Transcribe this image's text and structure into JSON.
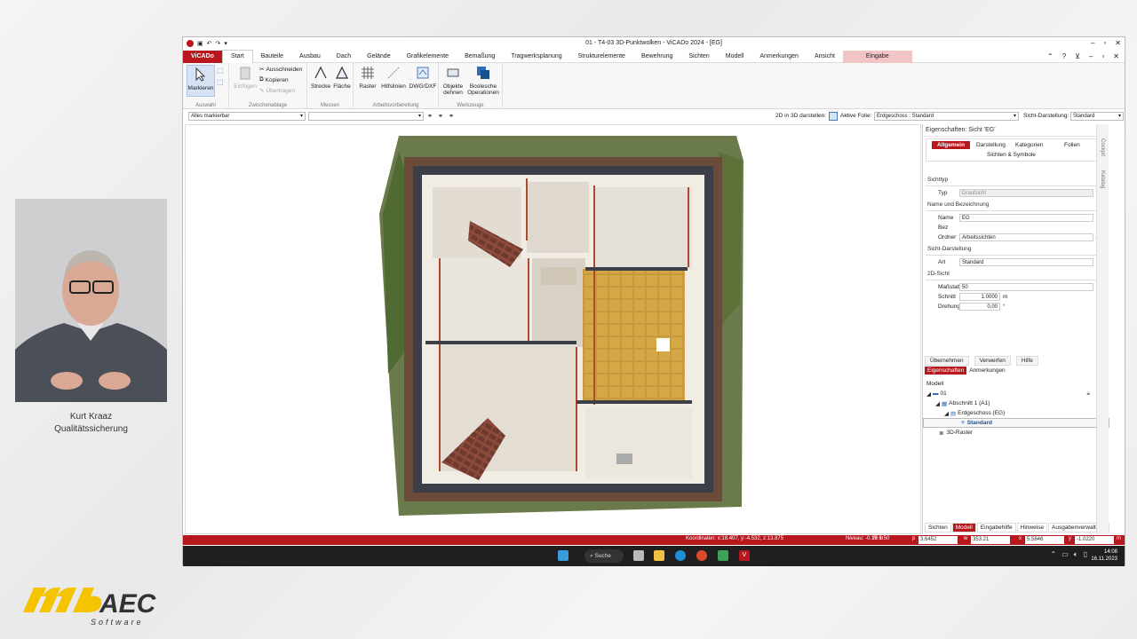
{
  "presenter": {
    "name": "Kurt Kraaz",
    "role": "Qualitätssicherung"
  },
  "logo": {
    "text": "mbAEC",
    "subtitle": "Software"
  },
  "window": {
    "title": "01 - T4-03 3D-Punktwolken - ViCADo 2024 - [EG]"
  },
  "menu": {
    "app_tab": "ViCADo",
    "tabs": [
      "Start",
      "Bauteile",
      "Ausbau",
      "Dach",
      "Gelände",
      "Grafikelemente",
      "Bemaßung",
      "Tragwerksplanung",
      "Strukturelemente",
      "Bewehrung",
      "Sichten",
      "Modell",
      "Anmerkungen",
      "Ansicht"
    ],
    "context_tab": "Eingabe"
  },
  "ribbon": {
    "auswahl": {
      "label": "Auswahl",
      "markieren": "Markieren"
    },
    "zwischenablage": {
      "label": "Zwischenablage",
      "einfuegen": "Einfügen",
      "ausschneiden": "Ausschneiden",
      "kopieren": "Kopieren",
      "uebertragen": "Übertragen"
    },
    "messen": {
      "label": "Messen",
      "strecke": "Strecke",
      "flaeche": "Fläche"
    },
    "arbeitsvorbereitung": {
      "label": "Arbeitsvorbereitung",
      "raster": "Raster",
      "hilfslinien": "Hilfslinien",
      "dwg": "DWG/DXF"
    },
    "werkzeuge": {
      "label": "Werkzeuge",
      "objekte1": "Objekte",
      "objekte2": "dehnen",
      "bool1": "Boolesche",
      "bool2": "Operationen"
    }
  },
  "options": {
    "filter": "Alles markierbar",
    "show3d_label": "2D in 3D darstellen:",
    "aktive_folie_label": "Aktive Folie:",
    "aktive_folie": "Erdgeschoss : Standard",
    "sicht_darstellung_label": "Sicht-Darstellung:",
    "sicht_darstellung": "Standard"
  },
  "properties": {
    "title": "Eigenschaften: Sicht 'EG'",
    "tabs": [
      "Allgemein",
      "Darstellung",
      "Kategorien",
      "Folien",
      "Sichten & Symbole"
    ],
    "sichttyp": {
      "header": "Sichttyp",
      "typ_label": "Typ",
      "typ": "Draufsicht"
    },
    "name": {
      "header": "Name und Bezeichnung",
      "name_label": "Name",
      "name": "EG",
      "bez_label": "Bez",
      "ordner_label": "Ordner",
      "ordner": "Arbeitssichten"
    },
    "darstellung": {
      "header": "Sicht-Darstellung",
      "art_label": "Art",
      "art": "Standard"
    },
    "sicht2d": {
      "header": "2D-Sicht",
      "massstab_label": "Maßstab",
      "massstab": "50",
      "schnitt_label": "Schnitt",
      "schnitt": "1.0000",
      "schnitt_unit": "m",
      "drehung_label": "Drehung",
      "drehung": "0.00",
      "drehung_unit": "°"
    },
    "buttons": [
      "Übernehmen",
      "Verwerfen",
      "Hilfe"
    ]
  },
  "model_panel": {
    "tabs": [
      "Eigenschaften",
      "Anmerkungen"
    ],
    "header": "Modell",
    "items": [
      "01",
      "Abschnitt 1 (A1)",
      "Erdgeschoss (EG)",
      "Standard",
      "3D-Raster"
    ]
  },
  "side_tabs": [
    "Cockpit",
    "Katalog"
  ],
  "bottom_tabs": [
    "Sichten",
    "Modell",
    "Eingabehilfe",
    "Hinweise",
    "Ausgabenverwaltung"
  ],
  "status": {
    "koordinaten": "Koordinaten: x:18.407, y:-4.532, z:13.875",
    "niveau": "Niveau: -0.15 m",
    "massstab": "M 1:50",
    "p_label": "p",
    "p": "3.6452",
    "w_label": "w",
    "w": "353.21",
    "x_label": "x",
    "x": "5.5846",
    "y_label": "y",
    "y": "-1.0220",
    "m_label": "m"
  },
  "taskbar": {
    "search": "Suche",
    "time": "14:08",
    "date": "16.11.2023"
  },
  "colors": {
    "accent": "#b7171d"
  }
}
